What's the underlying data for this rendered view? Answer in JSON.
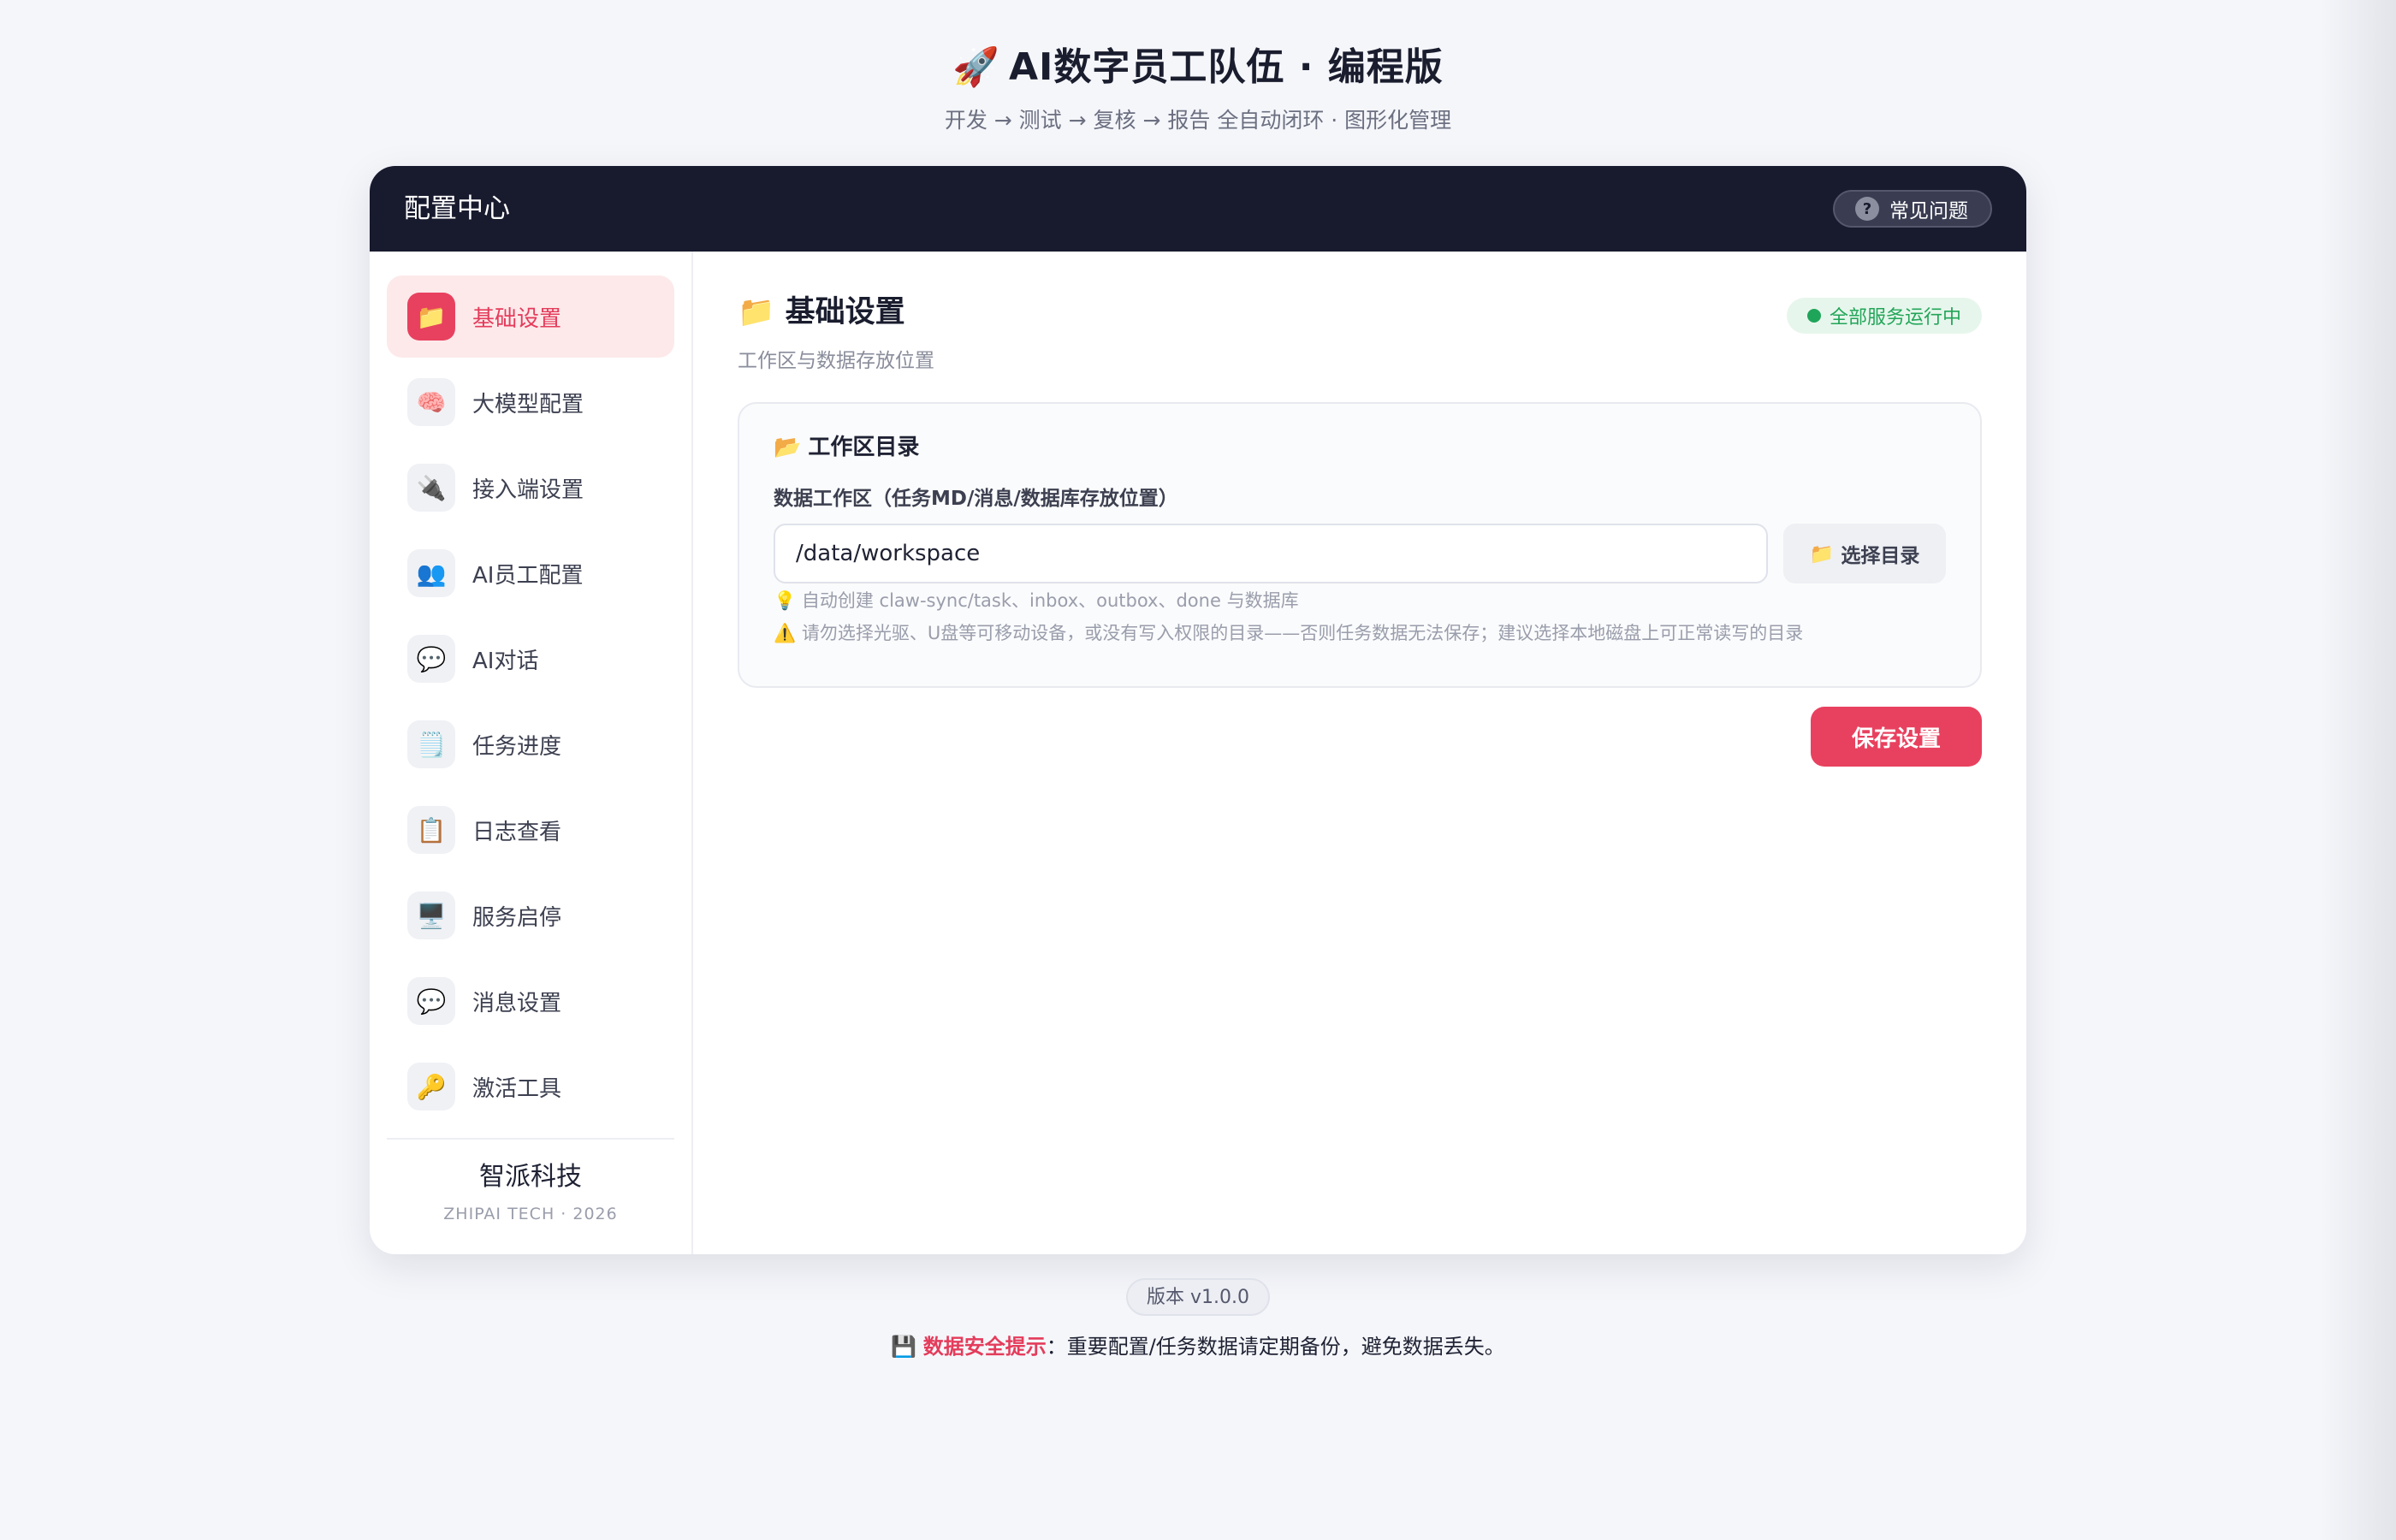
{
  "header": {
    "icon": "🚀",
    "title": "AI数字员工队伍 · 编程版",
    "subtitle": "开发 → 测试 → 复核 → 报告 全自动闭环 · 图形化管理"
  },
  "topbar": {
    "title": "配置中心",
    "faq_icon": "?",
    "faq_label": "常见问题"
  },
  "sidebar": {
    "items": [
      {
        "icon": "📁",
        "label": "基础设置",
        "active": true
      },
      {
        "icon": "🧠",
        "label": "大模型配置"
      },
      {
        "icon": "🔌",
        "label": "接入端设置"
      },
      {
        "icon": "👥",
        "label": "AI员工配置"
      },
      {
        "icon": "💬",
        "label": "AI对话"
      },
      {
        "icon": "🗒️",
        "label": "任务进度"
      },
      {
        "icon": "📋",
        "label": "日志查看"
      },
      {
        "icon": "🖥️",
        "label": "服务启停"
      },
      {
        "icon": "💬",
        "label": "消息设置"
      },
      {
        "icon": "🔑",
        "label": "激活工具"
      }
    ],
    "brand_name": "智派科技",
    "brand_sub": "ZHIPAI TECH · 2026"
  },
  "main": {
    "section_icon": "📁",
    "section_title": "基础设置",
    "section_desc": "工作区与数据存放位置",
    "status_text": "全部服务运行中",
    "status_color": "#1fa55a",
    "panel": {
      "icon": "📂",
      "title": "工作区目录",
      "field_label": "数据工作区（任务MD/消息/数据库存放位置）",
      "field_value": "/data/workspace",
      "choose_icon": "📁",
      "choose_label": "选择目录",
      "hint_icon_1": "💡",
      "hint_1": "自动创建 claw-sync/task、inbox、outbox、done 与数据库",
      "hint_icon_2": "⚠️",
      "hint_2": "请勿选择光驱、U盘等可移动设备，或没有写入权限的目录——否则任务数据无法保存；建议选择本地磁盘上可正常读写的目录"
    },
    "save_label": "保存设置"
  },
  "footer": {
    "version": "版本 v1.0.0",
    "safety_icon": "💾",
    "safety_strong": "数据安全提示",
    "safety_text": "：重要配置/任务数据请定期备份，避免数据丢失。"
  },
  "colors": {
    "accent": "#e8415f",
    "topbar": "#181a2e",
    "background": "#f5f6fa"
  }
}
